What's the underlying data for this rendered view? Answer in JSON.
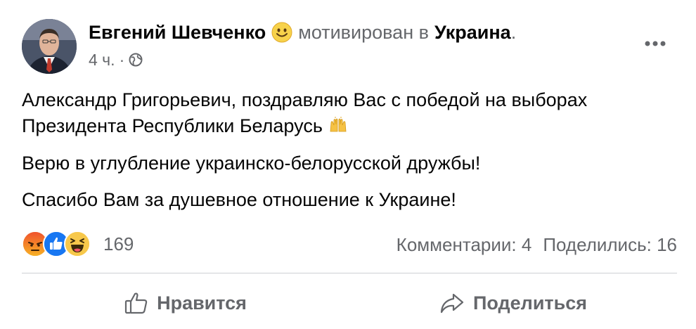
{
  "post": {
    "author": "Евгений Шевченко",
    "feeling": "мотивирован в",
    "place": "Украина",
    "place_suffix": ".",
    "time": "4 ч.",
    "meta_separator": "·",
    "paragraphs": [
      "Александр Григорьевич, поздравляю Вас с победой на  выборах Президента Республики Беларусь",
      "Верю в углубление украинско-белорусской дружбы!",
      "Спасибо Вам за душевное отношение к Украине!"
    ]
  },
  "reactions": {
    "icons": [
      "angry-reaction-icon",
      "like-reaction-icon",
      "haha-reaction-icon"
    ],
    "count": "169"
  },
  "stats": {
    "comments": "Комментарии: 4",
    "shares": "Поделились: 16"
  },
  "actions": {
    "like_label": "Нравится",
    "share_label": "Поделиться"
  },
  "colors": {
    "text": "#050505",
    "secondary": "#65676b",
    "divider": "#ced0d4",
    "like_blue": "#1877f2",
    "angry_orange": "#e9710f",
    "haha_yellow": "#f7c84b"
  }
}
